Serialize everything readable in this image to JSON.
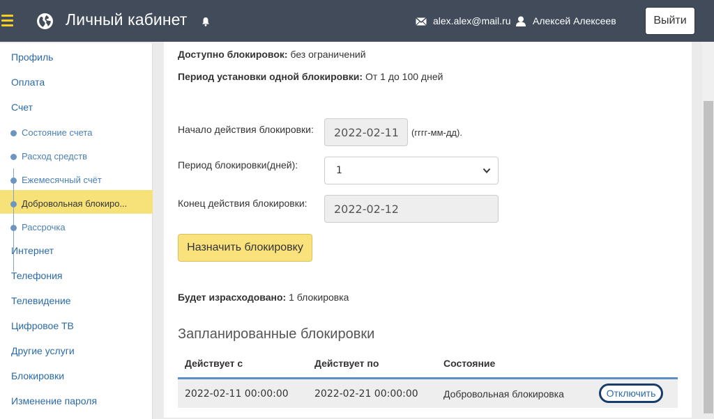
{
  "header": {
    "title": "Личный кабинет",
    "email": "alex.alex@mail.ru",
    "user": "Алексей Алексеев",
    "logout_label": "Выйти",
    "icons": [
      "menu-icon",
      "globe-icon",
      "bell-icon",
      "email-icon",
      "user-icon"
    ]
  },
  "sidebar": {
    "items": [
      {
        "label": "Профиль"
      },
      {
        "label": "Оплата"
      },
      {
        "label": "Счет"
      },
      {
        "label": "Состояние счета"
      },
      {
        "label": "Расход средств"
      },
      {
        "label": "Ежемесячный счёт"
      },
      {
        "label": "Добровольная блокиро..."
      },
      {
        "label": "Рассрочка"
      },
      {
        "label": "Интернет"
      },
      {
        "label": "Телефония"
      },
      {
        "label": "Телевидение"
      },
      {
        "label": "Цифровое ТВ"
      },
      {
        "label": "Другие услуги"
      },
      {
        "label": "Блокировки"
      },
      {
        "label": "Изменение пароля"
      }
    ]
  },
  "info": {
    "available_label": "Доступно блокировок:",
    "available_value": "без ограничений",
    "period_label": "Период установки одной блокировки:",
    "period_value": "От 1 до 100 дней"
  },
  "form": {
    "start_label": "Начало действия блокировки:",
    "start_value": "2022-02-11",
    "start_hint": "(гггг-мм-дд).",
    "period_label": "Период блокировки(дней):",
    "period_selected": "1",
    "end_label": "Конец действия блокировки:",
    "end_value": "2022-02-12",
    "submit_label": "Назначить блокировку"
  },
  "spend": {
    "label": "Будет израсходовано:",
    "value": "1 блокировка"
  },
  "scheduled": {
    "title": "Запланированные блокировки",
    "columns": [
      "Действует с",
      "Действует по",
      "Состояние"
    ],
    "rows": [
      {
        "from": "2022-02-11 00:00:00",
        "to": "2022-02-21 00:00:00",
        "state": "Добровольная блокировка",
        "action": "Отключить"
      }
    ]
  },
  "colors": {
    "header_bg": "#414b5a",
    "accent_yellow": "#f7e27a",
    "link_blue": "#2b6aa9",
    "table_border": "#5b8ec7"
  }
}
